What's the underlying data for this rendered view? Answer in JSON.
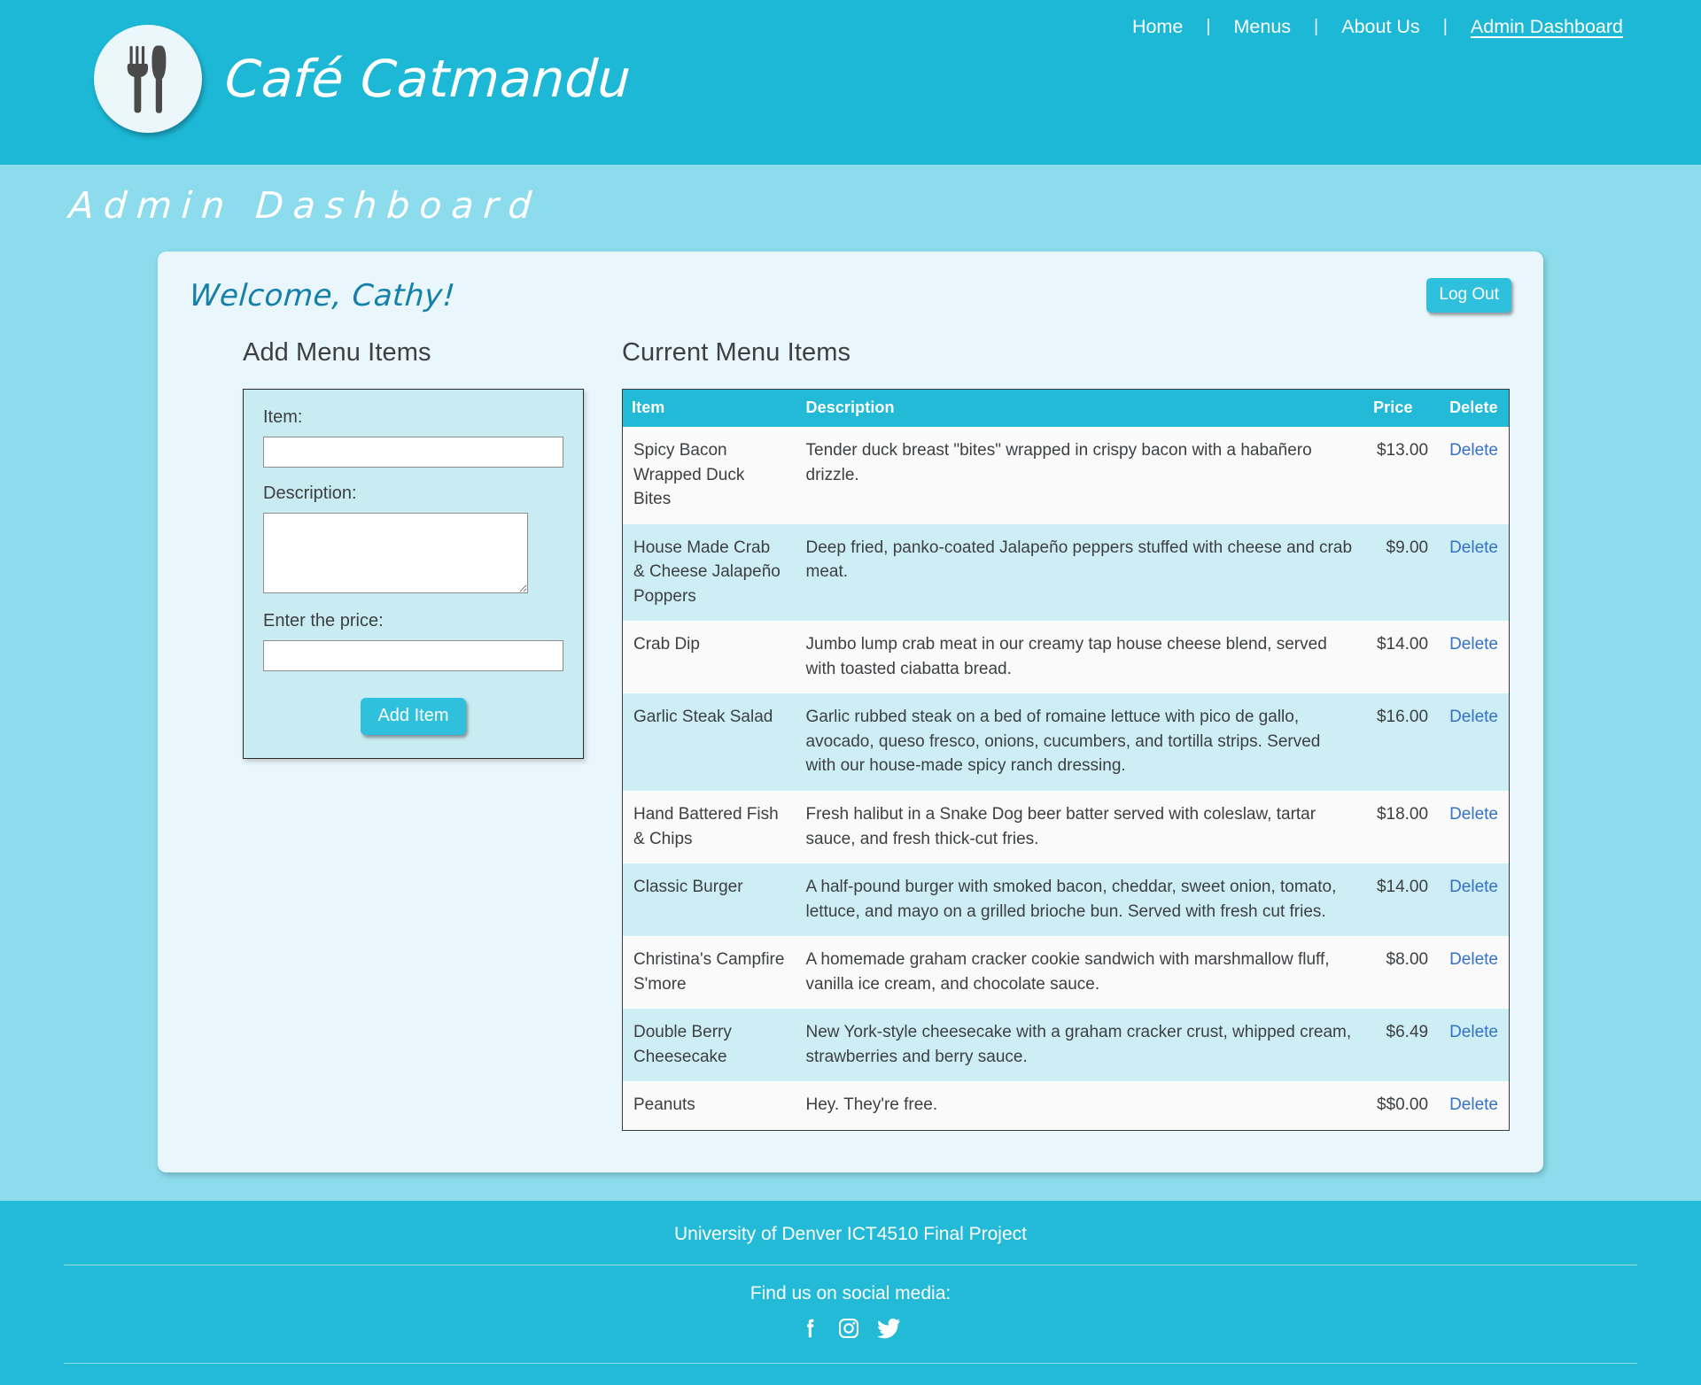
{
  "header": {
    "brand_name": "Café Catmandu",
    "logo_icon": "fork-and-knife-plate-icon",
    "nav": {
      "items": [
        {
          "label": "Home",
          "active": false
        },
        {
          "label": "Menus",
          "active": false
        },
        {
          "label": "About Us",
          "active": false
        },
        {
          "label": "Admin Dashboard",
          "active": true
        }
      ],
      "separator": "|"
    },
    "bg_color": "#1cb8d6"
  },
  "page": {
    "title": "Admin Dashboard",
    "bg_color": "#8cdced"
  },
  "card": {
    "welcome": "Welcome, Cathy!",
    "logout_label": "Log Out",
    "bg_color": "#e9f6fb"
  },
  "form": {
    "heading": "Add Menu Items",
    "item_label": "Item:",
    "item_value": "",
    "description_label": "Description:",
    "description_value": "",
    "price_label": "Enter the price:",
    "price_value": "",
    "submit_label": "Add Item"
  },
  "table": {
    "heading": "Current Menu Items",
    "columns": [
      "Item",
      "Description",
      "Price",
      "Delete"
    ],
    "header_bg": "#22bad6",
    "delete_label": "Delete",
    "rows": [
      {
        "item": "Spicy Bacon Wrapped Duck Bites",
        "description": "Tender duck breast \"bites\" wrapped in crispy bacon with a habañero drizzle.",
        "price": "$13.00",
        "delete": "Delete"
      },
      {
        "item": "House Made Crab & Cheese Jalapeño Poppers",
        "description": "Deep fried, panko-coated Jalapeño peppers stuffed with cheese and crab meat.",
        "price": "$9.00",
        "delete": "Delete"
      },
      {
        "item": "Crab Dip",
        "description": "Jumbo lump crab meat in our creamy tap house cheese blend, served with toasted ciabatta bread.",
        "price": "$14.00",
        "delete": "Delete"
      },
      {
        "item": "Garlic Steak Salad",
        "description": "Garlic rubbed steak on a bed of romaine lettuce with pico de gallo, avocado, queso fresco, onions, cucumbers, and tortilla strips. Served with our house-made spicy ranch dressing.",
        "price": "$16.00",
        "delete": "Delete"
      },
      {
        "item": "Hand Battered Fish & Chips",
        "description": "Fresh halibut in a Snake Dog beer batter served with coleslaw, tartar sauce, and fresh thick-cut fries.",
        "price": "$18.00",
        "delete": "Delete"
      },
      {
        "item": "Classic Burger",
        "description": "A half-pound burger with smoked bacon, cheddar, sweet onion, tomato, lettuce, and mayo on a grilled brioche bun. Served with fresh cut fries.",
        "price": "$14.00",
        "delete": "Delete"
      },
      {
        "item": "Christina's Campfire S'more",
        "description": "A homemade graham cracker cookie sandwich with marshmallow fluff, vanilla ice cream, and chocolate sauce.",
        "price": "$8.00",
        "delete": "Delete"
      },
      {
        "item": "Double Berry Cheesecake",
        "description": "New York-style cheesecake with a graham cracker crust, whipped cream, strawberries and berry sauce.",
        "price": "$6.49",
        "delete": "Delete"
      },
      {
        "item": "Peanuts",
        "description": "Hey. They're free.",
        "price": "$$0.00",
        "delete": "Delete"
      }
    ]
  },
  "footer": {
    "line1": "University of Denver ICT4510 Final Project",
    "line2": "Find us on social media:",
    "social": [
      {
        "name": "facebook-icon"
      },
      {
        "name": "instagram-icon"
      },
      {
        "name": "twitter-icon"
      }
    ],
    "bg_color": "#22bad6"
  }
}
